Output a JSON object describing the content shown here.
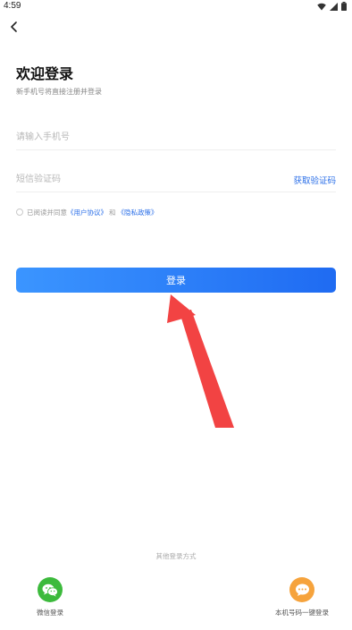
{
  "status_bar": {
    "time": "4:59"
  },
  "header": {
    "title": "欢迎登录",
    "subtitle": "新手机号将直接注册并登录"
  },
  "form": {
    "phone_placeholder": "请输入手机号",
    "code_placeholder": "短信验证码",
    "get_code_label": "获取验证码"
  },
  "agreement": {
    "prefix": "已阅读并同意",
    "user_agreement": "《用户协议》",
    "connector": "和",
    "privacy_policy": "《隐私政策》"
  },
  "login_button": {
    "label": "登录"
  },
  "other_methods": {
    "label": "其他登录方式",
    "wechat_label": "微信登录",
    "one_click_label": "本机号码一键登录"
  },
  "colors": {
    "accent": "#2b6fe8",
    "button_gradient_start": "#3b95ff",
    "button_gradient_end": "#1f6bf2",
    "wechat_green": "#3cba3c",
    "one_click_orange": "#f6a33c",
    "annotation_arrow": "#f24343"
  },
  "icons": {
    "back": "chevron-left-icon",
    "wechat": "wechat-icon",
    "one_click": "chat-bubble-icon"
  }
}
